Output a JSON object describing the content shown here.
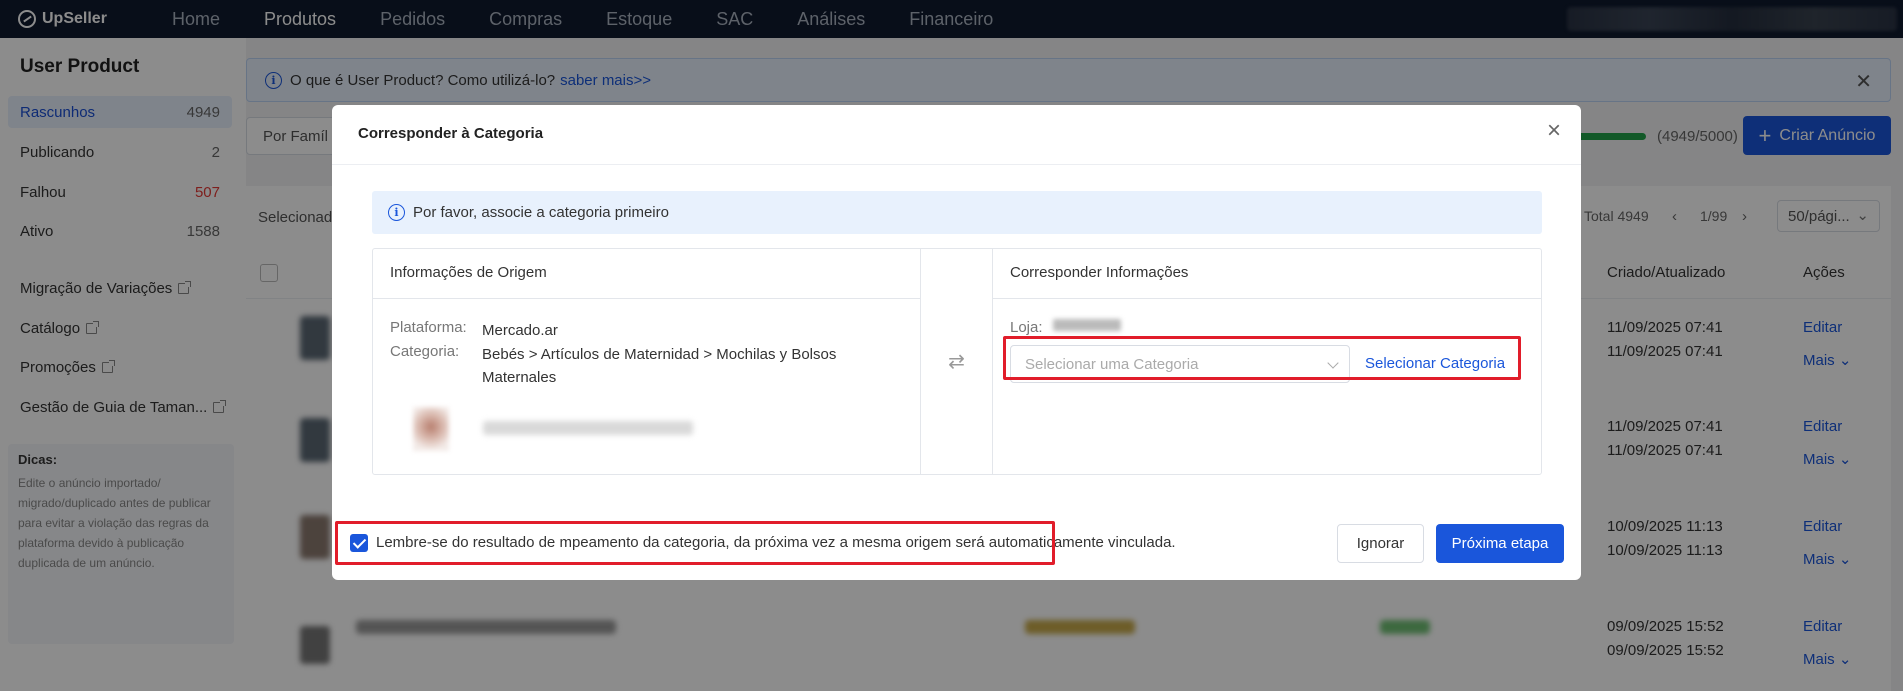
{
  "app": {
    "logo": "UpSeller"
  },
  "nav": [
    {
      "label": "Home",
      "active": false
    },
    {
      "label": "Produtos",
      "active": true
    },
    {
      "label": "Pedidos",
      "active": false
    },
    {
      "label": "Compras",
      "active": false
    },
    {
      "label": "Estoque",
      "active": false
    },
    {
      "label": "SAC",
      "active": false
    },
    {
      "label": "Análises",
      "active": false
    },
    {
      "label": "Financeiro",
      "active": false
    }
  ],
  "sidebar": {
    "title": "User Product",
    "items": [
      {
        "label": "Rascunhos",
        "count": "4949"
      },
      {
        "label": "Publicando",
        "count": "2"
      },
      {
        "label": "Falhou",
        "count": "507"
      },
      {
        "label": "Ativo",
        "count": "1588"
      }
    ],
    "links": [
      {
        "label": "Migração de Variações"
      },
      {
        "label": "Catálogo"
      },
      {
        "label": "Promoções"
      },
      {
        "label": "Gestão de Guia de Taman..."
      }
    ],
    "tips_title": "Dicas:",
    "tips_text": "Edite o anúncio importado/ migrado/duplicado antes de publicar para evitar a violação das regras da plataforma devido à publicação duplicada de um anúncio."
  },
  "banner": {
    "text": "O que é User Product? Como utilizá-lo?",
    "link": "saber mais>>"
  },
  "toolbar": {
    "filter": "Por Famíl",
    "quota": "(4949/5000)",
    "create": "Criar Anúncio"
  },
  "table": {
    "selected": "Selecionad",
    "total": "Total 4949",
    "page": "1/99",
    "per_page": "50/pági...",
    "columns": {
      "created": "Criado/Atualizado",
      "actions": "Ações"
    },
    "rows": [
      {
        "created": "11/09/2025 07:41",
        "updated": "11/09/2025 07:41",
        "edit": "Editar",
        "more": "Mais"
      },
      {
        "created": "11/09/2025 07:41",
        "updated": "11/09/2025 07:41",
        "edit": "Editar",
        "more": "Mais"
      },
      {
        "created": "10/09/2025 11:13",
        "updated": "10/09/2025 11:13",
        "edit": "Editar",
        "more": "Mais"
      },
      {
        "created": "09/09/2025 15:52",
        "updated": "09/09/2025 15:52",
        "edit": "Editar",
        "more": "Mais"
      }
    ]
  },
  "modal": {
    "title": "Corresponder à Categoria",
    "info": "Por favor, associe a categoria primeiro",
    "origin": {
      "header": "Informações de Origem",
      "platform_label": "Plataforma:",
      "platform_value": "Mercado.ar",
      "category_label": "Categoria:",
      "category_value": "Bebés > Artículos de Maternidad > Mochilas y Bolsos Maternales"
    },
    "match": {
      "header": "Corresponder Informações",
      "store_label": "Loja:",
      "select_placeholder": "Selecionar uma Categoria",
      "select_link": "Selecionar Categoria"
    },
    "remember": "Lembre-se do resultado de mpeamento da categoria, da próxima vez a mesma origem será automaticamente vinculada.",
    "remember_checked": true,
    "ignore": "Ignorar",
    "next": "Próxima etapa"
  },
  "colors": {
    "primary": "#1a56db",
    "highlight": "#e11d2a",
    "nav_bg": "#0f1a2e"
  }
}
